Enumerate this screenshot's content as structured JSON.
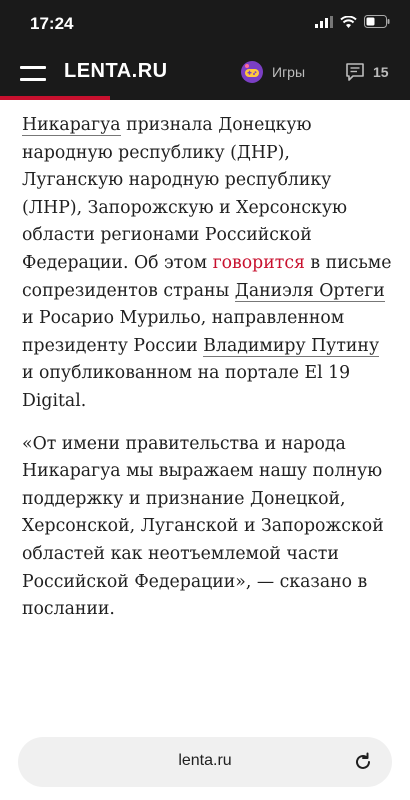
{
  "status_bar": {
    "time": "17:24"
  },
  "header": {
    "logo": "LENTA.RU",
    "games_label": "Игры",
    "comments_count": "15",
    "accent_color": "#c8102e"
  },
  "article": {
    "p1": {
      "link_nicaragua": "Никарагуа",
      "t1": " признала Донецкую народную республику (ДНР), Луганскую народную республику (ЛНР), Запорожскую и Херсонскую области регионами Российской Федерации. Об этом ",
      "link_says": "говорится",
      "t2": " в письме сопрезидентов страны ",
      "link_ortega": "Даниэля Ортеги",
      "t3": " и Росарио Мурильо, направленном президенту России ",
      "link_putin": "Владимиру Путину",
      "t4": " и опубликованном на портале El 19 Digital."
    },
    "p2": "«От имени правительства и народа Никарагуа мы выражаем нашу полную поддержку и признание Донецкой, Херсонской, Луганской и Запорожской областей как неотъемлемой части Российской Федерации», — сказано в послании."
  },
  "bottom_bar": {
    "url": "lenta.ru"
  }
}
